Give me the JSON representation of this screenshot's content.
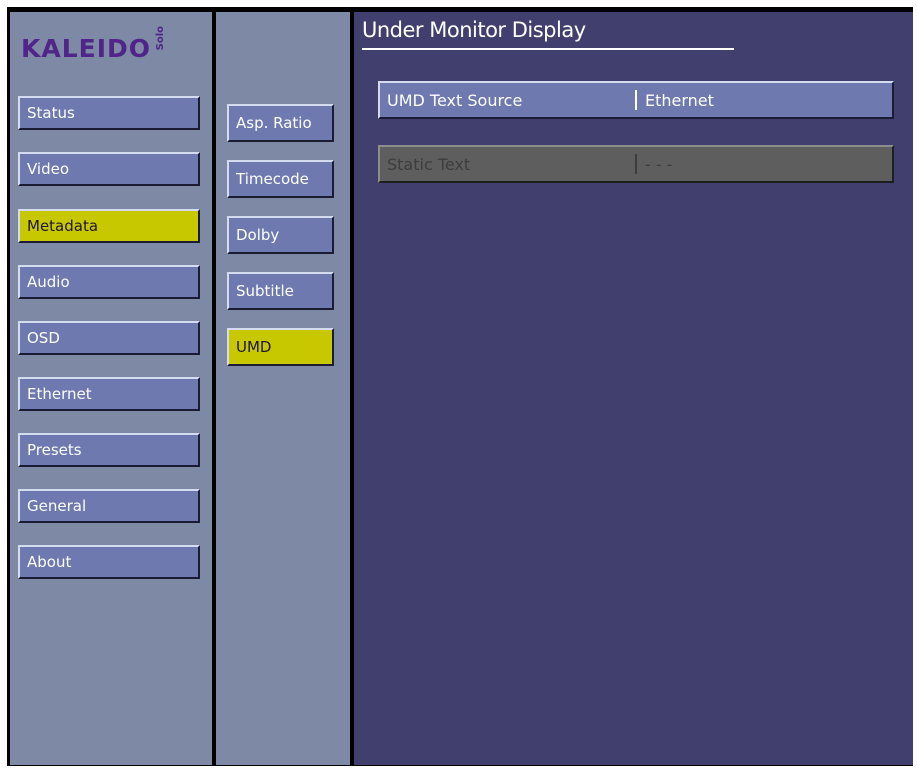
{
  "logo": {
    "main": "KALEIDO",
    "sub": "Solo"
  },
  "main_nav": [
    {
      "label": "Status",
      "active": false
    },
    {
      "label": "Video",
      "active": false
    },
    {
      "label": "Metadata",
      "active": true
    },
    {
      "label": "Audio",
      "active": false
    },
    {
      "label": "OSD",
      "active": false
    },
    {
      "label": "Ethernet",
      "active": false
    },
    {
      "label": "Presets",
      "active": false
    },
    {
      "label": "General",
      "active": false
    },
    {
      "label": "About",
      "active": false
    }
  ],
  "sub_nav": [
    {
      "label": "Asp. Ratio",
      "active": false
    },
    {
      "label": "Timecode",
      "active": false
    },
    {
      "label": "Dolby",
      "active": false
    },
    {
      "label": "Subtitle",
      "active": false
    },
    {
      "label": "UMD",
      "active": true
    }
  ],
  "page": {
    "title": "Under Monitor Display"
  },
  "settings": [
    {
      "label": "UMD Text Source",
      "value": "Ethernet",
      "enabled": true
    },
    {
      "label": "Static Text",
      "value": "- - -",
      "enabled": false
    }
  ],
  "colors": {
    "button": "#6d79af",
    "active": "#c7c800",
    "panel": "#7d89a5",
    "main_bg": "#413f6e",
    "logo": "#51248a"
  }
}
